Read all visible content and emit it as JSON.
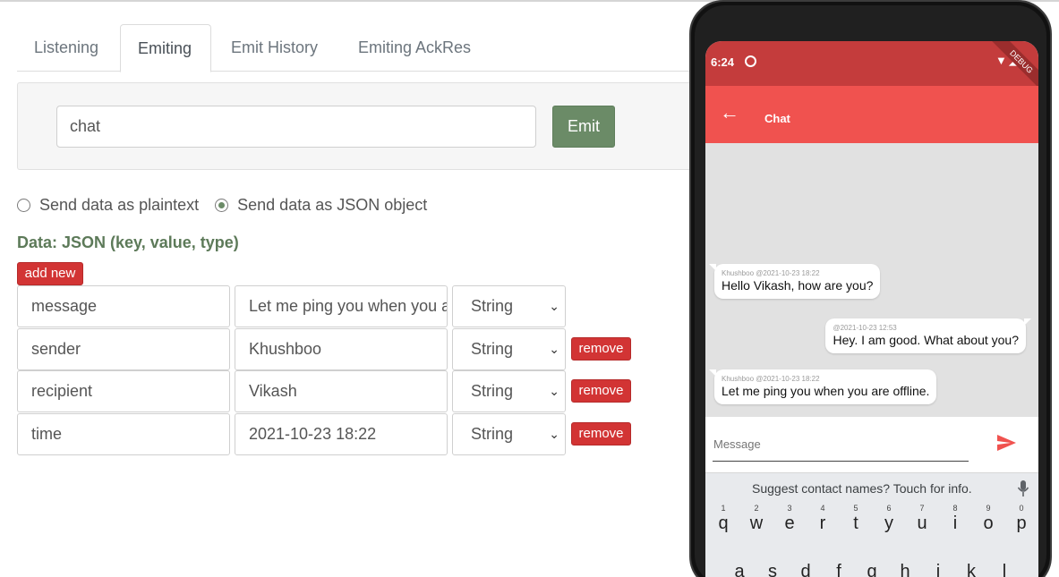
{
  "tabs": [
    {
      "label": "Listening",
      "active": false
    },
    {
      "label": "Emiting",
      "active": true
    },
    {
      "label": "Emit History",
      "active": false
    },
    {
      "label": "Emiting AckRes",
      "active": false
    }
  ],
  "emit": {
    "event_value": "chat",
    "button_label": "Emit"
  },
  "radio": {
    "plaintext_label": "Send data as plaintext",
    "json_label": "Send data as JSON object",
    "selected": "json"
  },
  "data_label": "Data: JSON (key, value, type)",
  "add_new_label": "add new",
  "remove_label": "remove",
  "rows": [
    {
      "key": "message",
      "value": "Let me ping you when you are offline.",
      "type": "String"
    },
    {
      "key": "sender",
      "value": "Khushboo",
      "type": "String"
    },
    {
      "key": "recipient",
      "value": "Vikash",
      "type": "String"
    },
    {
      "key": "time",
      "value": "2021-10-23 18:22",
      "type": "String"
    }
  ],
  "phone": {
    "status_time": "6:24",
    "debug_label": "DEBUG",
    "app_title": "Chat",
    "messages": [
      {
        "meta": "Khushboo @2021-10-23 18:22",
        "text": "Hello Vikash, how are you?",
        "side": "left"
      },
      {
        "meta": "@2021-10-23 12:53",
        "text": "Hey. I am good. What about you?",
        "side": "right"
      },
      {
        "meta": "Khushboo @2021-10-23 18:22",
        "text": "Let me ping you when you are offline.",
        "side": "left"
      }
    ],
    "compose_placeholder": "Message",
    "suggestion": "Suggest contact names? Touch for info.",
    "keyboard_row1": [
      {
        "num": "1",
        "ch": "q"
      },
      {
        "num": "2",
        "ch": "w"
      },
      {
        "num": "3",
        "ch": "e"
      },
      {
        "num": "4",
        "ch": "r"
      },
      {
        "num": "5",
        "ch": "t"
      },
      {
        "num": "6",
        "ch": "y"
      },
      {
        "num": "7",
        "ch": "u"
      },
      {
        "num": "8",
        "ch": "i"
      },
      {
        "num": "9",
        "ch": "o"
      },
      {
        "num": "0",
        "ch": "p"
      }
    ],
    "keyboard_row2": [
      "a",
      "s",
      "d",
      "f",
      "g",
      "h",
      "j",
      "k",
      "l"
    ]
  },
  "colors": {
    "accent_green": "#6b8b67",
    "danger_red": "#d23434",
    "status_bar": "#c43c3c",
    "app_bar": "#f0524f"
  }
}
